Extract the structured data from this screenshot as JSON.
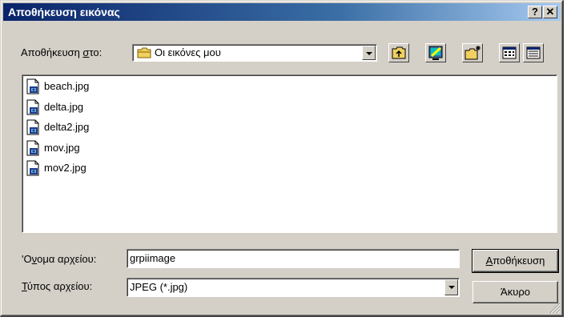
{
  "window": {
    "title": "Αποθήκευση εικόνας",
    "help_label": "?",
    "close_label": "✕"
  },
  "save_in": {
    "label_prefix": "Αποθήκευση ",
    "label_mnemonic": "σ",
    "label_suffix": "το:",
    "value": "Οι εικόνες μου"
  },
  "toolbar": {
    "icons": [
      "up-one-level-icon",
      "desktop-icon",
      "new-folder-icon",
      "list-view-icon",
      "details-view-icon"
    ]
  },
  "files": [
    {
      "name": "beach.jpg"
    },
    {
      "name": "delta.jpg"
    },
    {
      "name": "delta2.jpg"
    },
    {
      "name": "mov.jpg"
    },
    {
      "name": "mov2.jpg"
    }
  ],
  "filename": {
    "label_prefix": "'Ο",
    "label_mnemonic": "ν",
    "label_suffix": "ομα αρχείου:",
    "value": "grpiimage"
  },
  "filetype": {
    "label_mnemonic": "Τ",
    "label_suffix": "ύπος αρχείου:",
    "value": "JPEG (*.jpg)"
  },
  "buttons": {
    "save_mnemonic": "Α",
    "save_suffix": "ποθήκευση",
    "cancel": "Άκυρο"
  },
  "colors": {
    "title_start": "#0a246a",
    "title_end": "#a6caf0",
    "face": "#d4d0c8"
  }
}
